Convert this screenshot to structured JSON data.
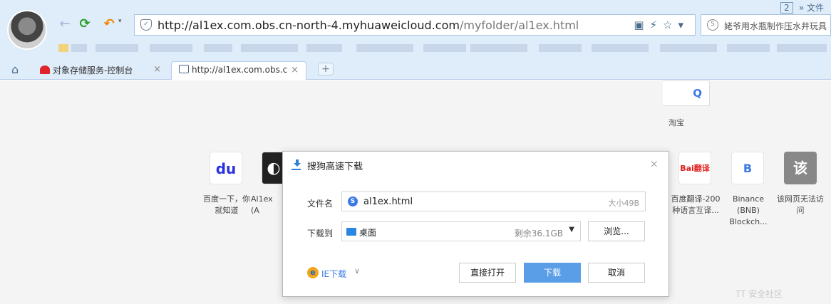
{
  "toolbar": {
    "back_icon": "←",
    "refresh_icon": "⟳",
    "undo_icon": "↶",
    "undo_caret": "▾"
  },
  "top_right": {
    "window_count": "2",
    "chevrons": "»",
    "menu_label": "文件"
  },
  "address": {
    "secure_icon": "✓",
    "url_host": "http://al1ex.com.obs.cn-north-4.myhuaweicloud.com",
    "url_path": "/myfolder/al1ex.html",
    "tools": "▣⚡☆▾"
  },
  "search": {
    "icon": "S",
    "text": "姥爷用水瓶制作压水井玩具"
  },
  "tabs": [
    {
      "label": "对象存储服务-控制台",
      "close": "×"
    },
    {
      "label": "http://al1ex.com.obs.c",
      "close": "×"
    }
  ],
  "newtab_label": "+",
  "home_icon": "⌂",
  "page": {
    "search_icon": "Q",
    "taobao": "淘宝",
    "tiles": [
      {
        "icon": "du",
        "label": "百度一下，你就知道"
      },
      {
        "icon": "◐",
        "label": "Al1ex (A"
      },
      {
        "icon": "Bai翻译",
        "label": "百度翻译-200种语言互译..."
      },
      {
        "icon": "B",
        "label": "Binance (BNB) Blockch..."
      },
      {
        "icon": "该",
        "label": "该网页无法访问"
      }
    ],
    "watermark": "TT 安全社区"
  },
  "dialog": {
    "title": "搜狗高速下载",
    "close": "×",
    "filename_label": "文件名",
    "filename_icon": "S",
    "filename": "al1ex.html",
    "filesize": "大小49B",
    "dest_label": "下载到",
    "dest_name": "桌面",
    "free_space": "剩余36.1GB",
    "dest_caret": "▼",
    "browse": "浏览...",
    "ie_icon": "e",
    "ie_label": "IE下载",
    "ie_caret": "∨",
    "open_direct": "直接打开",
    "download": "下载",
    "cancel": "取消"
  }
}
